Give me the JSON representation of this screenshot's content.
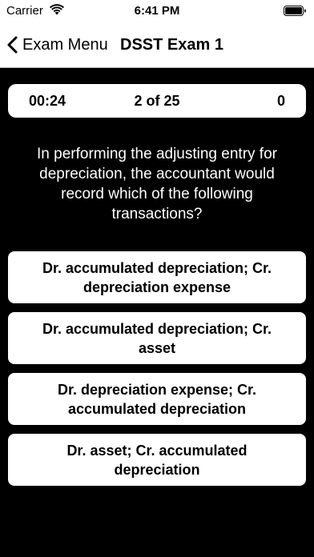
{
  "status_bar": {
    "carrier": "Carrier",
    "time": "6:41 PM"
  },
  "nav": {
    "back_label": "Exam Menu",
    "title": "DSST Exam 1"
  },
  "score_bar": {
    "timer": "00:24",
    "progress": "2 of 25",
    "score": "0"
  },
  "question": {
    "text": "In performing the adjusting entry for depreciation, the accountant would record which of the following transactions?"
  },
  "answers": [
    {
      "label": "Dr. accumulated depreciation; Cr. depreciation expense"
    },
    {
      "label": "Dr. accumulated depreciation; Cr. asset"
    },
    {
      "label": "Dr. depreciation expense; Cr. accumulated depreciation"
    },
    {
      "label": "Dr. asset; Cr. accumulated depreciation"
    }
  ],
  "colors": {
    "background": "#000000",
    "card": "#ffffff",
    "text_dark": "#000000",
    "text_light": "#ffffff"
  },
  "icons": {
    "wifi": "wifi-icon",
    "battery": "battery-icon",
    "back": "chevron-left-icon"
  }
}
